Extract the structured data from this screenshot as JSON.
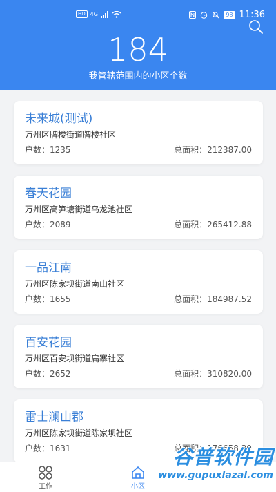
{
  "status_bar": {
    "network": "4G",
    "battery": "98",
    "time": "11:36"
  },
  "header": {
    "count": "184",
    "subtitle": "我管辖范围内的小区个数"
  },
  "labels": {
    "households": "户数：",
    "total_area": "总面积："
  },
  "communities": [
    {
      "name": "未来城(测试)",
      "address": "万州区牌楼街道牌楼社区",
      "households": "1235",
      "area": "212387.00"
    },
    {
      "name": "春天花园",
      "address": "万州区高笋塘街道乌龙池社区",
      "households": "2089",
      "area": "265412.88"
    },
    {
      "name": "一品江南",
      "address": "万州区陈家坝街道南山社区",
      "households": "1655",
      "area": "184987.52"
    },
    {
      "name": "百安花园",
      "address": "万州区百安坝街道扁寨社区",
      "households": "2652",
      "area": "310820.00"
    },
    {
      "name": "雷士澜山郡",
      "address": "万州区陈家坝街道陈家坝社区",
      "households": "1631",
      "area": "176658.39"
    }
  ],
  "tabs": [
    {
      "label": "工作",
      "icon": "grid-icon"
    },
    {
      "label": "小区",
      "icon": "home-icon"
    }
  ],
  "watermark": {
    "brand": "谷普软件园",
    "url": "www.gupuxlazal.com"
  },
  "colors": {
    "primary": "#3a86f0",
    "card_title": "#3a7fd6",
    "background": "#f2f3f5"
  }
}
